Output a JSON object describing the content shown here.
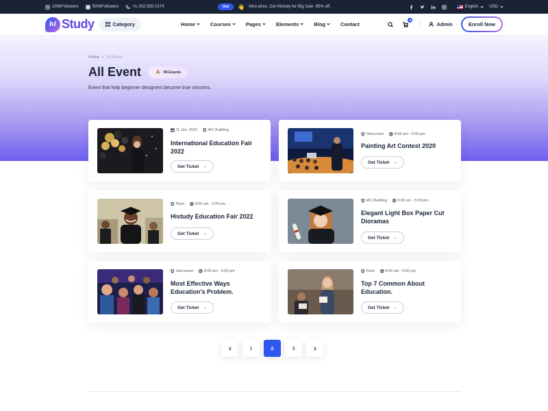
{
  "topbar": {
    "followers_1": "100kFollowers",
    "followers_2": "500kFollowers",
    "phone": "+1-202-555-0174",
    "hot_badge": "Hot",
    "promo_emoji": "👋",
    "promo_text": "Intro price. Get Histudy for Big Sale -95% off.",
    "language": "English",
    "currency": "USD"
  },
  "header": {
    "logo_mark": "hi",
    "logo_text": "Study",
    "category_label": "Category",
    "nav": [
      "Home",
      "Courses",
      "Pages",
      "Elements",
      "Blog",
      "Contact"
    ],
    "cart_count": "4",
    "admin_label": "Admin",
    "enroll_label": "Enroll Now"
  },
  "hero": {
    "breadcrumb": [
      "Home",
      "All Event"
    ],
    "title": "All Event",
    "badge_emoji": "🎉",
    "badge_text": "99 Events",
    "subtitle": "Event that help beginner designers become true unicorns."
  },
  "events": [
    {
      "meta_1": "11 Jan, 2023",
      "meta_2": "IAC Building",
      "title": "International Education Fair 2022",
      "button": "Get Ticket",
      "icon_1": "calendar-icon",
      "icon_2": "map-pin-icon"
    },
    {
      "meta_1": "Vancouver",
      "meta_2": "8:00 am - 5:00 pm",
      "title": "Painting Art Contest 2020",
      "button": "Get Ticket",
      "icon_1": "map-pin-icon",
      "icon_2": "clock-icon"
    },
    {
      "meta_1": "Paris",
      "meta_2": "8:00 am - 5:00 pm",
      "title": "Histudy Education Fair 2022",
      "button": "Get Ticket",
      "icon_1": "map-pin-icon",
      "icon_2": "clock-icon"
    },
    {
      "meta_1": "IAC Building",
      "meta_2": "8:00 am - 5:00 pm",
      "title": "Elegant Light Box Paper Cut Dioramas",
      "button": "Get Ticket",
      "icon_1": "map-pin-icon",
      "icon_2": "clock-icon"
    },
    {
      "meta_1": "Vancouver",
      "meta_2": "8:00 am - 5:00 pm",
      "title": "Most Effective Ways Education's Problem.",
      "button": "Get Ticket",
      "icon_1": "map-pin-icon",
      "icon_2": "clock-icon"
    },
    {
      "meta_1": "Paris",
      "meta_2": "8:00 am - 5:00 pm",
      "title": "Top 7 Common About Education.",
      "button": "Get Ticket",
      "icon_1": "map-pin-icon",
      "icon_2": "clock-icon"
    }
  ],
  "pagination": {
    "pages": [
      "1",
      "2",
      "3"
    ],
    "active": "2"
  },
  "colors": {
    "primary": "#2f57ef",
    "secondary": "#b966e7",
    "dark": "#192335"
  }
}
